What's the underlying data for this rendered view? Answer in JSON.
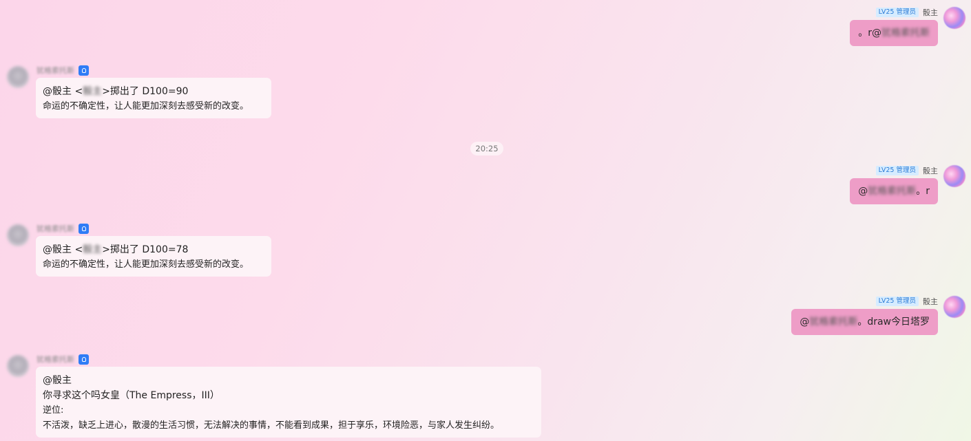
{
  "timestamp": "20:25",
  "out_user": {
    "badge": "LV25 管理员",
    "name": "骰主",
    "blurred_name": "犹格索托斯"
  },
  "bot": {
    "name": "犹格索托斯",
    "blurred_user": "骰主"
  },
  "messages": {
    "m1": {
      "prefix": "。r@",
      "suffix": ""
    },
    "m2": {
      "line1_a": "@骰主 <",
      "line1_b": ">掷出了 D100=90",
      "line2": "命运的不确定性，让人能更加深刻去感受新的改变。"
    },
    "m3": {
      "prefix": "@",
      "suffix": "。r"
    },
    "m4": {
      "line1_a": "@骰主 <",
      "line1_b": ">掷出了 D100=78",
      "line2": "命运的不确定性，让人能更加深刻去感受新的改变。"
    },
    "m5": {
      "prefix": "@",
      "suffix": "。draw今日塔罗"
    },
    "m6": {
      "line1": "@骰主",
      "line2": "你寻求这个吗女皇（The Empress，III）",
      "line3": "逆位:",
      "line4": "不活泼，缺乏上进心，散漫的生活习惯，无法解决的事情，不能看到成果，担于享乐，环境险恶，与家人发生纠纷。"
    }
  }
}
